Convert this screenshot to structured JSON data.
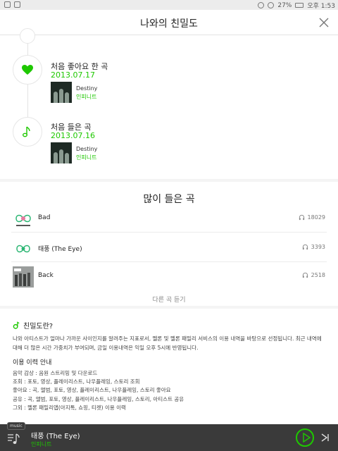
{
  "status_bar": {
    "battery": "27%",
    "time": "오후 1:53"
  },
  "header": {
    "title": "나와의 친밀도"
  },
  "timeline": [
    {
      "title": "처음 좋아요 한 곡",
      "date": "2013.07.17",
      "song": "Destiny",
      "artist": "인피니트",
      "icon": "heart-icon"
    },
    {
      "title": "처음 들은 곡",
      "date": "2013.07.16",
      "song": "Destiny",
      "artist": "인피니트",
      "icon": "music-note-icon"
    }
  ],
  "most_played": {
    "heading": "많이 들은 곡",
    "tracks": [
      {
        "name": "Bad",
        "count": "18029"
      },
      {
        "name": "태풍 (The Eye)",
        "count": "3393"
      },
      {
        "name": "Back",
        "count": "2518"
      }
    ],
    "more_label": "다른 곡 듣기"
  },
  "info": {
    "question": "친밀도란?",
    "description": "나와 아티스트가 얼마나 가까운 사이인지를 알려주는 지표로서, 멜론 및 멜론 패밀리 서비스의 이용 내역을 바탕으로 선정됩니다. 최근 내역에 대해 더 많은 시간 가중치가 부여되며, 금일 이용내역은 익일 오후 5시에 반영됩니다.",
    "usage_heading": "이용 이력 안내",
    "usage_lines": [
      "음악 감상 : 음원 스트리밍 및 다운로드",
      "조회 : 포토, 영상, 플레이리스트, 나우플레잉, 스토리 조회",
      "좋아요 : 곡, 앨범, 포토, 영상, 플레이리스트, 나우플레잉, 스토리  좋아요",
      "공유 : 곡, 앨범, 포토, 영상, 플레이리스트, 나우플레잉, 스토리, 아티스트 공유",
      "그외 : 멜론 패밀리앱(아지톡, 쇼핑, 티켓) 이용 이력"
    ]
  },
  "player": {
    "badge": "music",
    "title": "태풍 (The Eye)",
    "artist": "인피니트"
  },
  "colors": {
    "accent": "#1ec800",
    "player_bg": "#3a3a3a"
  }
}
